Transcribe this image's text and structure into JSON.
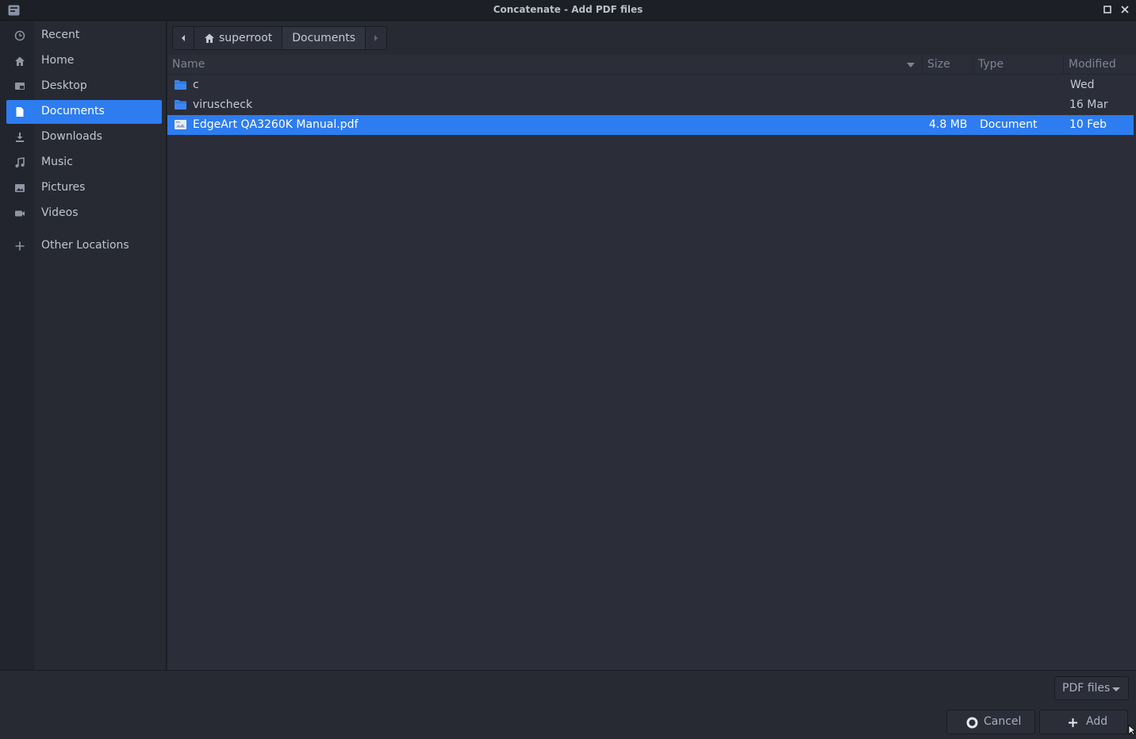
{
  "window": {
    "title": "Concatenate - Add PDF files"
  },
  "sidebar": {
    "items": [
      {
        "label": "Recent",
        "icon": "clock-icon"
      },
      {
        "label": "Home",
        "icon": "home-icon"
      },
      {
        "label": "Desktop",
        "icon": "desktop-icon"
      },
      {
        "label": "Documents",
        "icon": "document-icon",
        "active": true
      },
      {
        "label": "Downloads",
        "icon": "download-icon"
      },
      {
        "label": "Music",
        "icon": "music-icon"
      },
      {
        "label": "Pictures",
        "icon": "picture-icon"
      },
      {
        "label": "Videos",
        "icon": "video-icon"
      },
      {
        "label": "Other Locations",
        "icon": "plus-icon"
      }
    ]
  },
  "pathbar": {
    "crumbs": [
      "superroot",
      "Documents"
    ]
  },
  "filelist": {
    "columns": {
      "name": "Name",
      "size": "Size",
      "type": "Type",
      "modified": "Modified"
    },
    "rows": [
      {
        "name": "c",
        "size": "",
        "type": "",
        "modified": "Wed",
        "icon": "folder-icon"
      },
      {
        "name": "viruscheck",
        "size": "",
        "type": "",
        "modified": "16 Mar",
        "icon": "folder-icon"
      },
      {
        "name": "EdgeArt QA3260K Manual.pdf",
        "size": "4.8 MB",
        "type": "Document",
        "modified": "10 Feb",
        "icon": "pdf-file-icon",
        "selected": true
      }
    ]
  },
  "footer": {
    "filter": "PDF files",
    "cancel_label": "Cancel",
    "add_label": "Add"
  },
  "colors": {
    "accent": "#2d7cf0",
    "background": "#2b2e38"
  }
}
